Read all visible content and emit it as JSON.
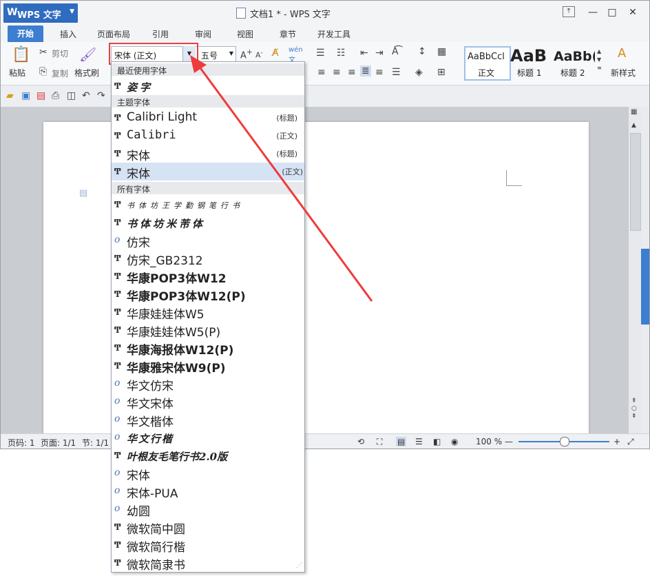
{
  "app": {
    "name": "WPS 文字",
    "logo": "W",
    "title": "文档1 * - WPS 文字"
  },
  "tabs": [
    "开始",
    "插入",
    "页面布局",
    "引用",
    "审阅",
    "视图",
    "章节",
    "开发工具"
  ],
  "ribbon": {
    "paste": "粘贴",
    "cut": "剪切",
    "copy": "复制",
    "format_painter": "格式刷",
    "font_value": "宋体 (正文)",
    "size_value": "五号",
    "styles": [
      {
        "preview": "AaBbCcl",
        "label": "正文"
      },
      {
        "preview": "AaB",
        "label": "标题 1"
      },
      {
        "preview": "AaBb(",
        "label": "标题 2"
      }
    ],
    "new_style": "新样式"
  },
  "font_dropdown": {
    "recent_header": "最近使用字体",
    "recent": [
      {
        "name": "姿字",
        "icon": "truetype-icon",
        "style": "script"
      }
    ],
    "theme_header": "主题字体",
    "theme": [
      {
        "name": "Calibri Light",
        "tag": "(标题)"
      },
      {
        "name": "Calibri",
        "tag": "(正文)"
      },
      {
        "name": "宋体",
        "tag": "(标题)"
      },
      {
        "name": "宋体",
        "tag": "(正文)",
        "selected": true
      }
    ],
    "all_header": "所有字体",
    "all": [
      {
        "name": "书体坊王学勤钢笔行书",
        "icon": "truetype-icon",
        "style": "thin"
      },
      {
        "name": "书体坊米芾体",
        "icon": "truetype-icon",
        "style": "script"
      },
      {
        "name": "仿宋",
        "icon": "opentype-icon",
        "style": "normal"
      },
      {
        "name": "仿宋_GB2312",
        "icon": "truetype-icon",
        "style": "normal"
      },
      {
        "name": "华康POP3体W12",
        "icon": "truetype-icon",
        "style": "bold"
      },
      {
        "name": "华康POP3体W12(P)",
        "icon": "truetype-icon",
        "style": "bold"
      },
      {
        "name": "华康娃娃体W5",
        "icon": "truetype-icon",
        "style": "normal"
      },
      {
        "name": "华康娃娃体W5(P)",
        "icon": "truetype-icon",
        "style": "normal"
      },
      {
        "name": "华康海报体W12(P)",
        "icon": "truetype-icon",
        "style": "bold"
      },
      {
        "name": "华康雅宋体W9(P)",
        "icon": "truetype-icon",
        "style": "bold"
      },
      {
        "name": "华文仿宋",
        "icon": "opentype-icon",
        "style": "normal"
      },
      {
        "name": "华文宋体",
        "icon": "opentype-icon",
        "style": "normal"
      },
      {
        "name": "华文楷体",
        "icon": "opentype-icon",
        "style": "normal"
      },
      {
        "name": "华文行楷",
        "icon": "opentype-icon",
        "style": "script"
      },
      {
        "name": "叶根友毛笔行书2.0版",
        "icon": "truetype-icon",
        "style": "script"
      },
      {
        "name": "宋体",
        "icon": "opentype-icon",
        "style": "normal"
      },
      {
        "name": "宋体-PUA",
        "icon": "opentype-icon",
        "style": "normal"
      },
      {
        "name": "幼圆",
        "icon": "opentype-icon",
        "style": "normal"
      },
      {
        "name": "微软简中圆",
        "icon": "truetype-icon",
        "style": "normal"
      },
      {
        "name": "微软简行楷",
        "icon": "truetype-icon",
        "style": "normal"
      },
      {
        "name": "微软简隶书",
        "icon": "truetype-icon",
        "style": "normal"
      }
    ]
  },
  "status": {
    "page": "页码: 1",
    "pages": "页面: 1/1",
    "section": "节: 1/1",
    "zoom": "100 %"
  },
  "colors": {
    "accent": "#3c7ed0",
    "highlight": "#e84040"
  }
}
